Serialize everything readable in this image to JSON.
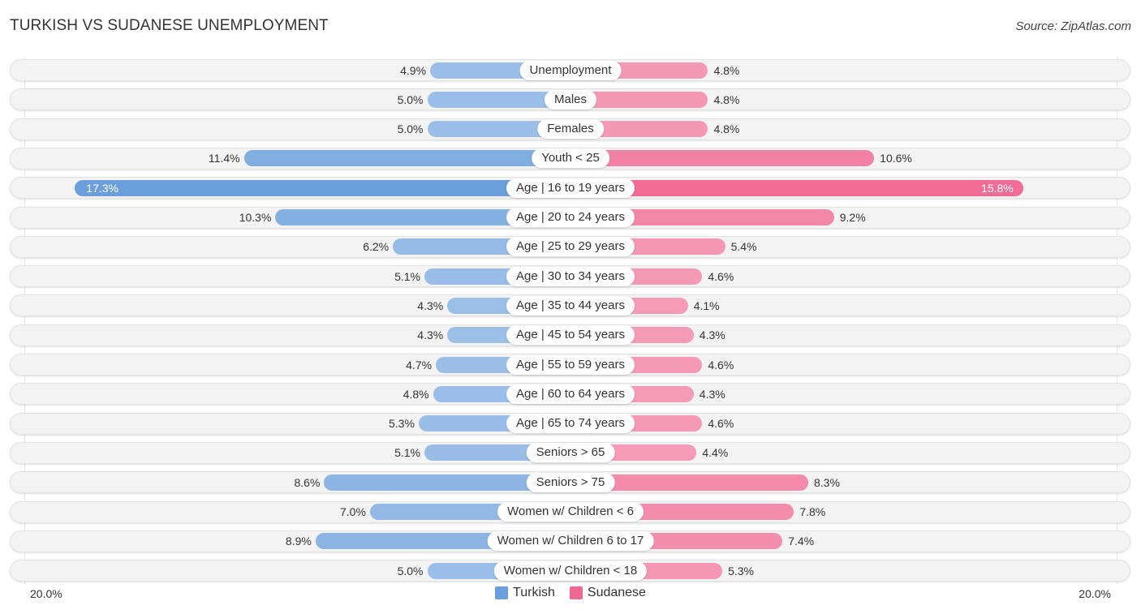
{
  "header": {
    "title": "TURKISH VS SUDANESE UNEMPLOYMENT",
    "source": "Source: ZipAtlas.com"
  },
  "chart_data": {
    "type": "bar",
    "orientation": "horizontal-diverging",
    "title": "TURKISH VS SUDANESE UNEMPLOYMENT",
    "unit": "%",
    "xlim": [
      -20,
      20
    ],
    "axis_tick_labels": {
      "left": "20.0%",
      "right": "20.0%"
    },
    "legend_position": "bottom-center",
    "categories": [
      "Unemployment",
      "Males",
      "Females",
      "Youth < 25",
      "Age | 16 to 19 years",
      "Age | 20 to 24 years",
      "Age | 25 to 29 years",
      "Age | 30 to 34 years",
      "Age | 35 to 44 years",
      "Age | 45 to 54 years",
      "Age | 55 to 59 years",
      "Age | 60 to 64 years",
      "Age | 65 to 74 years",
      "Seniors > 65",
      "Seniors > 75",
      "Women w/ Children < 6",
      "Women w/ Children 6 to 17",
      "Women w/ Children < 18"
    ],
    "series": [
      {
        "name": "Turkish",
        "color": "#6a9fdb",
        "side": "left",
        "values": [
          4.9,
          5.0,
          5.0,
          11.4,
          17.3,
          10.3,
          6.2,
          5.1,
          4.3,
          4.3,
          4.7,
          4.8,
          5.3,
          5.1,
          8.6,
          7.0,
          8.9,
          5.0
        ],
        "labels": [
          "4.9%",
          "5.0%",
          "5.0%",
          "11.4%",
          "17.3%",
          "10.3%",
          "6.2%",
          "5.1%",
          "4.3%",
          "4.3%",
          "4.7%",
          "4.8%",
          "5.3%",
          "5.1%",
          "8.6%",
          "7.0%",
          "8.9%",
          "5.0%"
        ]
      },
      {
        "name": "Sudanese",
        "color": "#f06792",
        "side": "right",
        "values": [
          4.8,
          4.8,
          4.8,
          10.6,
          15.8,
          9.2,
          5.4,
          4.6,
          4.1,
          4.3,
          4.6,
          4.3,
          4.6,
          4.4,
          8.3,
          7.8,
          7.4,
          5.3
        ],
        "labels": [
          "4.8%",
          "4.8%",
          "4.8%",
          "10.6%",
          "15.8%",
          "9.2%",
          "5.4%",
          "4.6%",
          "4.1%",
          "4.3%",
          "4.6%",
          "4.3%",
          "4.6%",
          "4.4%",
          "8.3%",
          "7.8%",
          "7.4%",
          "5.3%"
        ]
      }
    ]
  },
  "legend": {
    "items": [
      {
        "label": "Turkish",
        "color": "#6a9fdb"
      },
      {
        "label": "Sudanese",
        "color": "#f06792"
      }
    ]
  }
}
